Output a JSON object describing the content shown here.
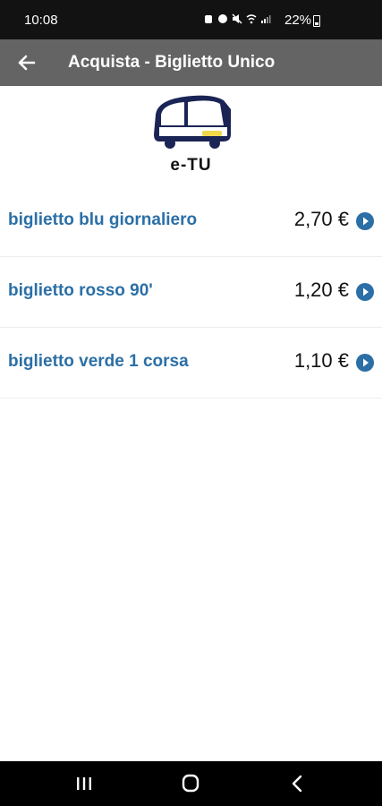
{
  "status_bar": {
    "time": "10:08",
    "battery_text": "22%"
  },
  "app_bar": {
    "title": "Acquista - Biglietto Unico",
    "back_icon": "arrow-left-icon"
  },
  "logo": {
    "text": "e-TU",
    "icon": "bus-icon"
  },
  "tickets": [
    {
      "name": "biglietto blu giornaliero",
      "price": "2,70 €"
    },
    {
      "name": "biglietto rosso 90'",
      "price": "1,20 €"
    },
    {
      "name": "biglietto verde 1 corsa",
      "price": "1,10 €"
    }
  ],
  "colors": {
    "accent": "#2b6fa6",
    "app_bar": "#646464"
  }
}
